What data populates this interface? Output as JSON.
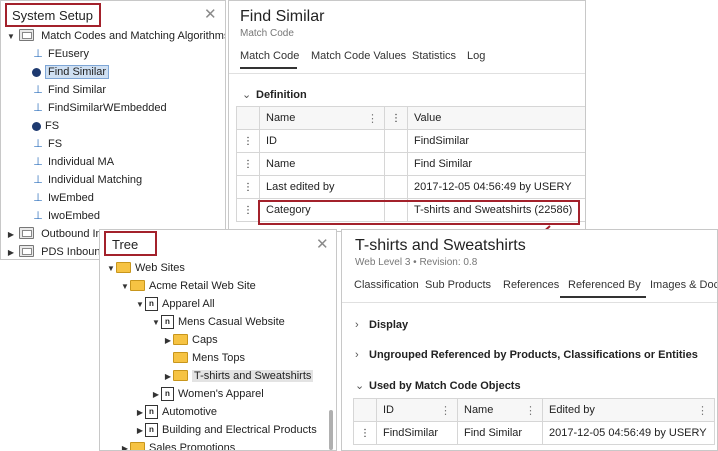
{
  "system_setup": {
    "title": "System Setup",
    "tree": [
      {
        "label": "Match Codes and Matching Algorithms",
        "icon": "folder-settings-icon",
        "expanded": true
      },
      {
        "label": "FEusery",
        "icon": "match-code-icon"
      },
      {
        "label": "Find Similar",
        "icon": "matching-algorithm-icon",
        "selected": true
      },
      {
        "label": "Find Similar",
        "icon": "match-code-icon"
      },
      {
        "label": "FindSimilarWEmbedded",
        "icon": "match-code-icon"
      },
      {
        "label": "FS",
        "icon": "matching-algorithm-icon"
      },
      {
        "label": "FS",
        "icon": "match-code-icon"
      },
      {
        "label": "Individual MA",
        "icon": "match-code-icon"
      },
      {
        "label": "Individual Matching",
        "icon": "match-code-icon"
      },
      {
        "label": "IwEmbed",
        "icon": "match-code-icon"
      },
      {
        "label": "IwoEmbed",
        "icon": "match-code-icon"
      },
      {
        "label": "Outbound Int",
        "icon": "folder-settings-icon",
        "expanded": false
      },
      {
        "label": "PDS Inbound",
        "icon": "folder-settings-icon",
        "expanded": false
      }
    ]
  },
  "find_similar": {
    "title": "Find Similar",
    "subtitle": "Match Code",
    "tabs": [
      "Match Code",
      "Match Code Values",
      "Statistics",
      "Log"
    ],
    "active_tab": "Match Code",
    "section": "Definition",
    "columns": [
      "Name",
      "Value"
    ],
    "rows": [
      {
        "name": "ID",
        "value": "FindSimilar"
      },
      {
        "name": "Name",
        "value": "Find Similar"
      },
      {
        "name": "Last edited by",
        "value": "2017-12-05 04:56:49 by USERY"
      },
      {
        "name": "Category",
        "value": "T-shirts and Sweatshirts (22586)"
      }
    ]
  },
  "tree_panel": {
    "title": "Tree",
    "items": [
      {
        "label": "Web Sites",
        "icon": "folder-icon",
        "level": 0,
        "twisty": "expanded"
      },
      {
        "label": "Acme Retail Web Site",
        "icon": "folder-icon",
        "level": 1,
        "twisty": "expanded"
      },
      {
        "label": "Apparel All",
        "icon": "product-icon",
        "level": 2,
        "twisty": "expanded"
      },
      {
        "label": "Mens Casual Website",
        "icon": "product-icon",
        "level": 3,
        "twisty": "expanded"
      },
      {
        "label": "Caps",
        "icon": "folder-icon",
        "level": 4,
        "twisty": "collapsed"
      },
      {
        "label": "Mens Tops",
        "icon": "folder-icon",
        "level": 4,
        "twisty": "none"
      },
      {
        "label": "T-shirts and Sweatshirts",
        "icon": "folder-icon",
        "level": 4,
        "twisty": "collapsed",
        "selected": true
      },
      {
        "label": "Women's Apparel",
        "icon": "product-icon",
        "level": 3,
        "twisty": "collapsed"
      },
      {
        "label": "Automotive",
        "icon": "product-icon",
        "level": 2,
        "twisty": "collapsed"
      },
      {
        "label": "Building and Electrical Products",
        "icon": "product-icon",
        "level": 2,
        "twisty": "collapsed"
      },
      {
        "label": "Sales Promotions",
        "icon": "folder-icon",
        "level": 1,
        "twisty": "collapsed"
      }
    ]
  },
  "tshirts": {
    "title": "T-shirts and Sweatshirts",
    "meta": "Web Level 3 • Revision: 0.8",
    "tabs": [
      "Classification",
      "Sub Products",
      "References",
      "Referenced By",
      "Images & Docu"
    ],
    "active_tab": "Referenced By",
    "sections": [
      "Display",
      "Ungrouped Referenced by Products, Classifications or Entities",
      "Used by Match Code Objects"
    ],
    "columns": [
      "ID",
      "Name",
      "Edited by"
    ],
    "rows": [
      {
        "id": "FindSimilar",
        "name": "Find Similar",
        "edited": "2017-12-05 04:56:49 by USERY"
      }
    ]
  },
  "colors": {
    "accent_red": "#a3212b",
    "selection": "#cfe0f3"
  }
}
